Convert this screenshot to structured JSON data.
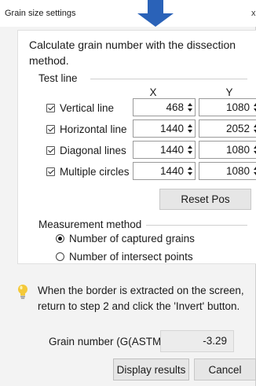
{
  "window": {
    "title": "Grain size settings",
    "close_glyph": "x"
  },
  "intro": "Calculate grain number with the dissection method.",
  "test_line": {
    "label": "Test line",
    "col_x": "X",
    "col_y": "Y",
    "rows": [
      {
        "label": "Vertical line",
        "checked": true,
        "x": "468",
        "y": "1080"
      },
      {
        "label": "Horizontal line",
        "checked": true,
        "x": "1440",
        "y": "2052"
      },
      {
        "label": "Diagonal lines",
        "checked": true,
        "x": "1440",
        "y": "1080"
      },
      {
        "label": "Multiple circles",
        "checked": true,
        "x": "1440",
        "y": "1080"
      }
    ],
    "reset_label": "Reset Pos"
  },
  "measurement": {
    "label": "Measurement method",
    "options": [
      {
        "label": "Number of captured grains",
        "selected": true
      },
      {
        "label": "Number of intersect points",
        "selected": false
      }
    ]
  },
  "hint": "When the border is extracted on the screen, return to step 2 and click the 'Invert' button.",
  "result": {
    "label": "Grain number (G(ASTM)):",
    "value": "-3.29"
  },
  "buttons": {
    "display": "Display results",
    "cancel": "Cancel"
  },
  "colors": {
    "arrow": "#2a62b8",
    "bulb": "#f4c93a",
    "dialog_bg": "#f3f3f3"
  },
  "icons": {
    "arrow": "down-arrow-icon",
    "bulb": "lightbulb-icon"
  }
}
